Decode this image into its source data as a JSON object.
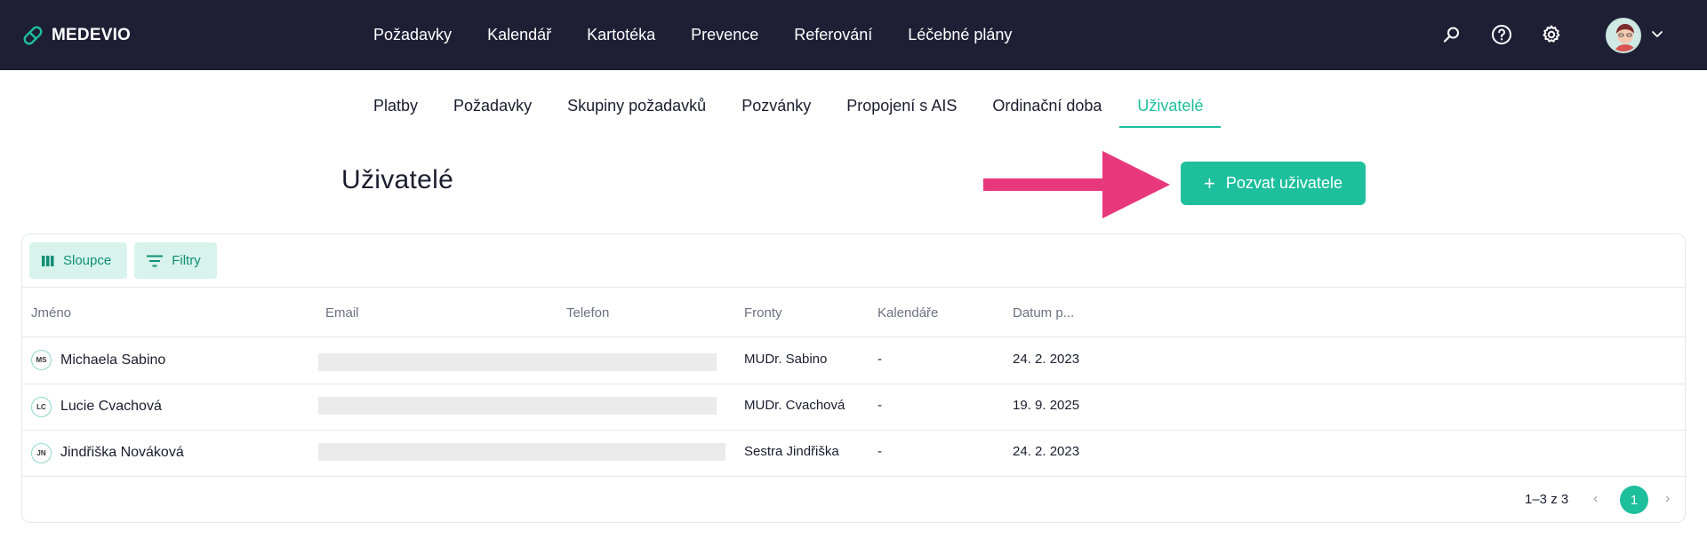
{
  "app": {
    "logo_text": "MEDEVIO",
    "brand_color": "#1dbf9c",
    "topbar_color": "#1e1f35"
  },
  "main_nav": {
    "items": [
      "Požadavky",
      "Kalendář",
      "Kartotéka",
      "Prevence",
      "Referování",
      "Léčebné plány"
    ]
  },
  "header_icons": [
    "search-icon",
    "help-icon",
    "gear-icon",
    "avatar",
    "chevron-down-icon"
  ],
  "sub_nav": {
    "tabs": [
      "Platby",
      "Požadavky",
      "Skupiny požadavků",
      "Pozvánky",
      "Propojení s AIS",
      "Ordinační doba",
      "Uživatelé"
    ],
    "active": "Uživatelé"
  },
  "page": {
    "title": "Uživatelé",
    "invite_label": "Pozvat uživatele"
  },
  "toolbar": {
    "columns_label": "Sloupce",
    "filters_label": "Filtry"
  },
  "table": {
    "headers": [
      "Jméno",
      "Email",
      "Telefon",
      "Fronty",
      "Kalendáře",
      "Datum p..."
    ],
    "rows": [
      {
        "initials": "MS",
        "name": "Michaela Sabino",
        "queue": "MUDr. Sabino",
        "calendars": "-",
        "date": "24. 2. 2023"
      },
      {
        "initials": "LC",
        "name": "Lucie Cvachová",
        "queue": "MUDr. Cvachová",
        "calendars": "-",
        "date": "19. 9. 2025"
      },
      {
        "initials": "JN",
        "name": "Jindřiška Nováková",
        "queue": "Sestra Jindřiška",
        "calendars": "-",
        "date": "24. 2. 2023"
      }
    ]
  },
  "pagination": {
    "count": "1–3 z 3",
    "current_page": "1"
  }
}
